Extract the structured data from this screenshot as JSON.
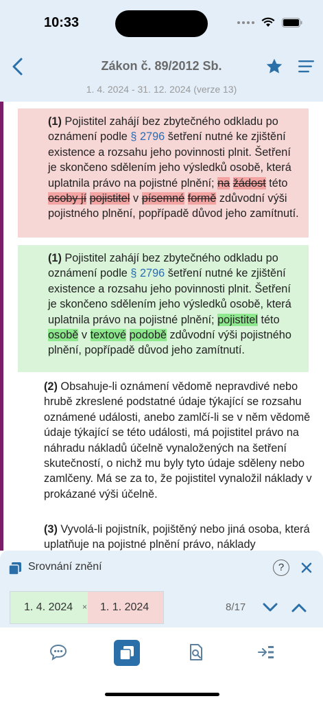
{
  "status": {
    "time": "10:33"
  },
  "header": {
    "title": "Zákon č. 89/2012 Sb.",
    "subtitle": "1. 4. 2024 - 31. 12. 2024 (verze 13)"
  },
  "old_block": {
    "num": "(1)",
    "t1": " Pojistitel zahájí bez zbytečného odkladu po oznámení podle ",
    "link": "§ 2796",
    "t2": " šetření nutné ke zjištění existence a rozsahu jeho povinnosti plnit. Šetření je skončeno sdělením jeho výsledků osobě, která uplatnila právo na pojistné plnění; ",
    "del1": "na",
    "del2": "žádost",
    "t3": " této ",
    "del3": "osoby jí",
    "del4": "pojistitel",
    "t4": " v ",
    "del5": "písemné",
    "del6": "formě",
    "t5": " zdůvodní výši pojistného plnění, popřípadě důvod jeho zamítnutí."
  },
  "new_block": {
    "num": "(1)",
    "t1": " Pojistitel zahájí bez zbytečného odkladu po oznámení podle ",
    "link": "§ 2796",
    "t2": " šetření nutné ke zjištění existence a rozsahu jeho povinnosti plnit. Šetření je skončeno sdělením jeho výsledků osobě, která uplatnila právo na pojistné plnění; ",
    "ins1": "pojistitel",
    "t3": " této ",
    "ins2": "osobě",
    "t4": " v ",
    "ins3": "textové",
    "ins4": "podobě",
    "t5": " zdůvodní výši pojistného plnění, popřípadě důvod jeho zamítnutí."
  },
  "para2": {
    "num": "(2)",
    "text": " Obsahuje-li oznámení vědomě nepravdivé nebo hrubě zkreslené podstatné údaje týkající se rozsahu oznámené události, anebo zamlčí-li se v něm vědomě údaje týkající se této události, má pojistitel právo na náhradu nákladů účelně vynaložených na šetření skutečností, o nichž mu byly tyto údaje sděleny nebo zamlčeny. Má se za to, že pojistitel vynaložil náklady v prokázané výši účelně."
  },
  "para3": {
    "num": "(3)",
    "text": " Vyvolá-li pojistník, pojištěný nebo jiná osoba, která uplatňuje na pojistné plnění právo, náklady"
  },
  "compare": {
    "title": "Srovnání znění",
    "help": "?",
    "date_from": "1. 4. 2024",
    "sep": "×",
    "date_to": "1. 1. 2024",
    "counter": "8/17"
  },
  "colors": {
    "header_bg": "#e3eef8",
    "accent": "#2a6fa8",
    "deleted_bg": "#f7d6d6",
    "inserted_bg": "#d9f4d9",
    "side_bar": "#7b1e67"
  },
  "icons": {
    "back": "chevron-left-icon",
    "favorite": "star-icon",
    "menu": "hamburger-icon",
    "compare": "copy-icon",
    "help": "help-icon",
    "close": "close-icon",
    "prev": "chevron-down-icon",
    "next": "chevron-up-icon",
    "tab_comments": "comments-icon",
    "tab_compare": "compare-icon",
    "tab_search": "search-document-icon",
    "tab_jump": "jump-to-icon"
  }
}
